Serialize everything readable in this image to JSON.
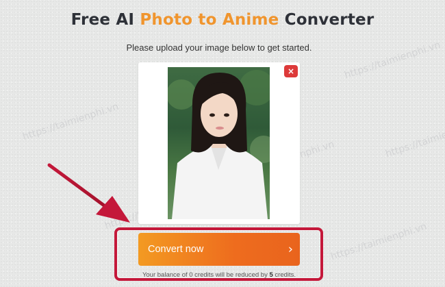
{
  "header": {
    "title_part1": "Free AI ",
    "title_highlight": "Photo to Anime",
    "title_part2": " Converter",
    "subtitle": "Please upload your image below to get started."
  },
  "upload_card": {
    "close_symbol": "×"
  },
  "convert": {
    "button_label": "Convert now",
    "chevron": "›",
    "balance_prefix": "Your balance of 0 credits will be reduced by ",
    "balance_credits": "5",
    "balance_suffix": " credits."
  },
  "watermarks": [
    "https://taimienphi.vn",
    "https://taimienphi.vn",
    "https://taimienphi.vn",
    "https://taimienphi.vn",
    "https://taimienphi.vn",
    "https://taimienphi.vn"
  ],
  "colors": {
    "accent": "#f0952e",
    "button_start": "#f39a22",
    "button_end": "#e9641d",
    "close": "#dd3a3a",
    "annotation": "#c4183a"
  }
}
